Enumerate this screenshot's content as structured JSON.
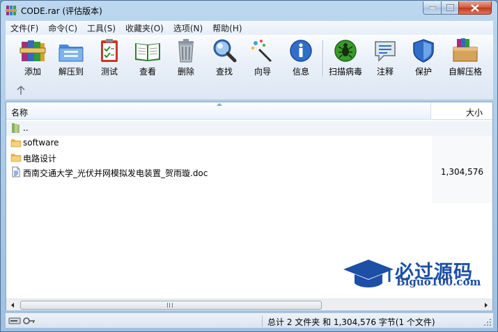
{
  "window": {
    "title": "CODE.rar (评估版本)"
  },
  "menu": [
    "文件(F)",
    "命令(C)",
    "工具(S)",
    "收藏夹(O)",
    "选项(N)",
    "帮助(H)"
  ],
  "toolbar": [
    {
      "label": "添加",
      "icon": "add-books-icon"
    },
    {
      "label": "解压到",
      "icon": "extract-folder-icon"
    },
    {
      "label": "测试",
      "icon": "test-clipboard-icon"
    },
    {
      "label": "查看",
      "icon": "view-book-icon"
    },
    {
      "label": "删除",
      "icon": "trash-icon"
    },
    {
      "label": "查找",
      "icon": "magnifier-icon"
    },
    {
      "label": "向导",
      "icon": "wizard-wand-icon"
    },
    {
      "label": "信息",
      "icon": "info-icon"
    },
    {
      "label": "扫描病毒",
      "icon": "virus-scan-icon"
    },
    {
      "label": "注释",
      "icon": "comment-icon"
    },
    {
      "label": "保护",
      "icon": "shield-icon"
    },
    {
      "label": "自解压格",
      "icon": "sfx-box-icon"
    }
  ],
  "columns": {
    "name": "名称",
    "size": "大小"
  },
  "files": [
    {
      "name": "..",
      "size": "",
      "type": "parent"
    },
    {
      "name": "software",
      "size": "",
      "type": "folder"
    },
    {
      "name": "电路设计",
      "size": "",
      "type": "folder"
    },
    {
      "name": "西南交通大学_光伏并网模拟发电装置_贺雨璇.doc",
      "size": "1,304,576",
      "type": "doc"
    }
  ],
  "watermark": {
    "title": "必过源码",
    "url": "Biguo100.com"
  },
  "status": {
    "summary": "总计 2 文件夹 和 1,304,576 字节(1 个文件)"
  }
}
